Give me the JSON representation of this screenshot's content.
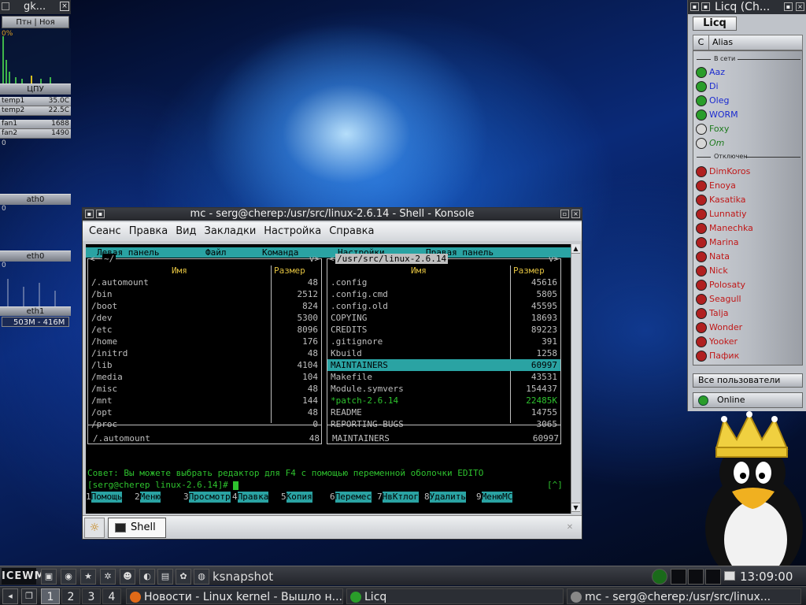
{
  "gkrellm": {
    "title": "gk...",
    "clock": "Птн | Ноя",
    "cpu_pct": "0%",
    "cpu_label": "ЦПУ",
    "sensors": [
      {
        "name": "temp1",
        "value": "35.0C"
      },
      {
        "name": "temp2",
        "value": "22.5C"
      },
      {
        "name": "fan1",
        "value": "1688"
      },
      {
        "name": "fan2",
        "value": "1490"
      }
    ],
    "zero": "0",
    "net1": "ath0",
    "net2": "eth0",
    "net3": "eth1",
    "mem": "503M - 416M"
  },
  "licq": {
    "window_title": "Licq (Ch...",
    "logo": "Licq",
    "col_c": "C",
    "col_alias": "Alias",
    "group_online": "В сети",
    "group_offline": "Отключен",
    "online_users": [
      {
        "name": "Aaz",
        "color": "#1a2ad0"
      },
      {
        "name": "Di",
        "color": "#1a2ad0"
      },
      {
        "name": "Oleg",
        "color": "#1a2ad0"
      },
      {
        "name": "WORM",
        "color": "#1a2ad0"
      },
      {
        "name": "Foxy",
        "color": "#1e7a1e"
      },
      {
        "name": "Om",
        "color": "#1e7a1e"
      }
    ],
    "offline_users": [
      "DimKoros",
      "Enoya",
      "Kasatika",
      "Lunnatiy",
      "Manechka",
      "Marina",
      "Nata",
      "Nick",
      "Polosaty",
      "Seagull",
      "Talja",
      "Wonder",
      "Yooker",
      "Пафик"
    ],
    "offline_color": "#c01818",
    "all_users": "Все пользователи",
    "status": "Online"
  },
  "konsole": {
    "title": "mc - serg@cherep:/usr/src/linux-2.6.14 - Shell - Konsole",
    "menu": [
      "Сеанс",
      "Правка",
      "Вид",
      "Закладки",
      "Настройка",
      "Справка"
    ],
    "tab_label": "Shell"
  },
  "mc": {
    "menubar": [
      "Левая панель",
      "Файл",
      "Команда",
      "Настройки",
      "Правая панель"
    ],
    "left_path": "~/",
    "right_path": "/usr/src/linux-2.6.14",
    "col_name": "Имя",
    "col_size": "Размер",
    "left_files": [
      {
        "name": "/.automount",
        "size": "48"
      },
      {
        "name": "/bin",
        "size": "2512"
      },
      {
        "name": "/boot",
        "size": "824"
      },
      {
        "name": "/dev",
        "size": "5300"
      },
      {
        "name": "/etc",
        "size": "8096"
      },
      {
        "name": "/home",
        "size": "176"
      },
      {
        "name": "/initrd",
        "size": "48"
      },
      {
        "name": "/lib",
        "size": "4104"
      },
      {
        "name": "/media",
        "size": "104"
      },
      {
        "name": "/misc",
        "size": "48"
      },
      {
        "name": "/mnt",
        "size": "144"
      },
      {
        "name": "/opt",
        "size": "48"
      },
      {
        "name": "/proc",
        "size": "0"
      }
    ],
    "right_files": [
      {
        "name": ".config",
        "size": "45616"
      },
      {
        "name": ".config.cmd",
        "size": "5805"
      },
      {
        "name": ".config.old",
        "size": "45595"
      },
      {
        "name": "COPYING",
        "size": "18693"
      },
      {
        "name": "CREDITS",
        "size": "89223"
      },
      {
        "name": ".gitignore",
        "size": "391"
      },
      {
        "name": "Kbuild",
        "size": "1258"
      },
      {
        "name": "MAINTAINERS",
        "size": "60997"
      },
      {
        "name": "Makefile",
        "size": "43531"
      },
      {
        "name": "Module.symvers",
        "size": "154437"
      },
      {
        "name": "*patch-2.6.14",
        "size": "22485K"
      },
      {
        "name": "README",
        "size": "14755"
      },
      {
        "name": "REPORTING-BUGS",
        "size": "3065"
      }
    ],
    "right_selected_index": 7,
    "right_exec_index": 10,
    "left_status_name": "/.automount",
    "left_status_size": "48",
    "right_status_name": "MAINTAINERS",
    "right_status_size": "60997",
    "hint": "Совет: Вы можете выбрать редактор для F4 с помощью переменной оболочки EDITO",
    "prompt": "[serg@cherep linux-2.6.14]# ",
    "prompt_tail": "[^]",
    "fkeys": [
      {
        "n": "1",
        "label": "Помощь"
      },
      {
        "n": "2",
        "label": "Меню"
      },
      {
        "n": "3",
        "label": "Просмотр"
      },
      {
        "n": "4",
        "label": "Правка"
      },
      {
        "n": "5",
        "label": "Копия"
      },
      {
        "n": "6",
        "label": "Перемес"
      },
      {
        "n": "7",
        "label": "НвКтлог"
      },
      {
        "n": "8",
        "label": "Удалить"
      },
      {
        "n": "9",
        "label": "МенюMC"
      }
    ]
  },
  "panel": {
    "logo": "ICEWM",
    "app_name": "ksnapshot",
    "clock": "13:09:00",
    "desktops": [
      "1",
      "2",
      "3",
      "4"
    ],
    "active_desktop": 0,
    "tasks": [
      {
        "label": "Новости - Linux kernel - Вышло н...",
        "color": "#e06a18"
      },
      {
        "label": "Licq",
        "color": "#2a9d2a"
      },
      {
        "label": "mc - serg@cherep:/usr/src/linux...",
        "color": "#888888"
      }
    ]
  }
}
